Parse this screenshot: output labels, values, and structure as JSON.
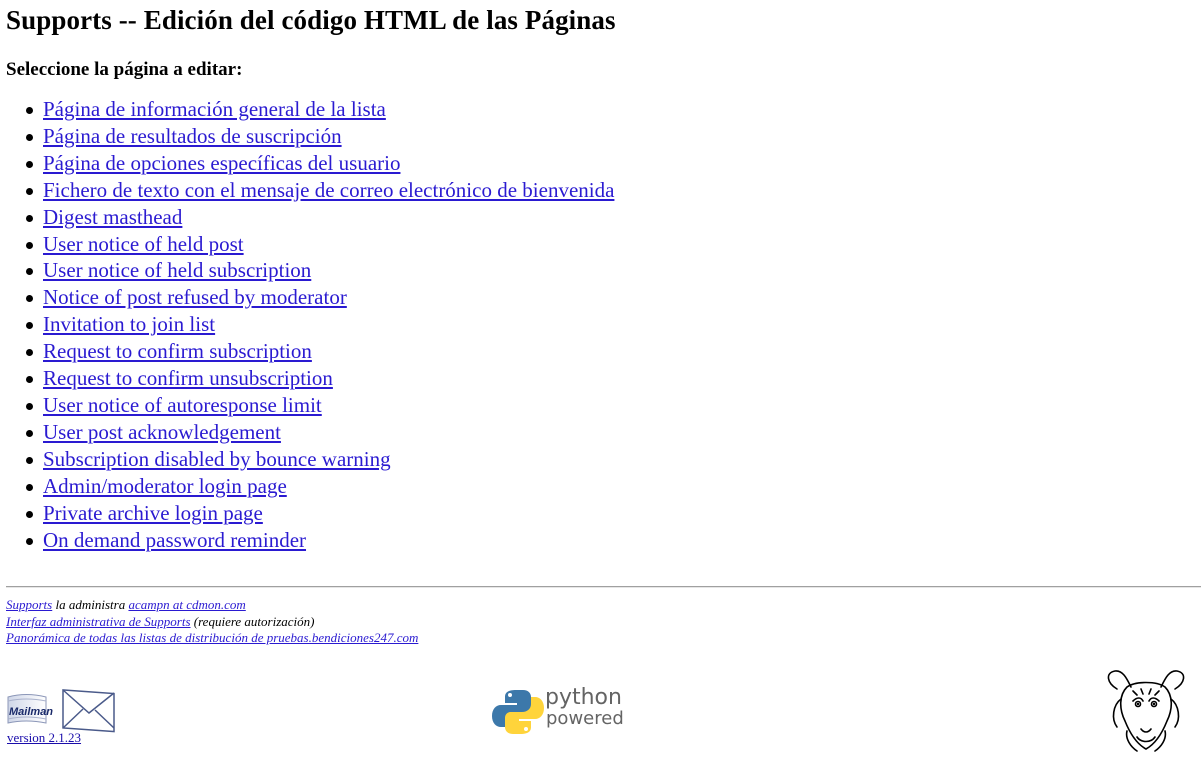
{
  "page": {
    "title": "Supports -- Edición del código HTML de las Páginas",
    "subtitle": "Seleccione la página a editar:"
  },
  "items": [
    "Página de información general de la lista",
    "Página de resultados de suscripción",
    "Página de opciones específicas del usuario",
    "Fichero de texto con el mensaje de correo electrónico de bienvenida",
    "Digest masthead",
    "User notice of held post",
    "User notice of held subscription",
    "Notice of post refused by moderator",
    "Invitation to join list",
    "Request to confirm subscription",
    "Request to confirm unsubscription",
    "User notice of autoresponse limit",
    "User post acknowledgement",
    "Subscription disabled by bounce warning",
    "Admin/moderator login page",
    "Private archive login page",
    "On demand password reminder"
  ],
  "footer": {
    "list_name": "Supports",
    "admin_text": " la administra ",
    "admin_email": "acampn at cdmon.com",
    "admin_interface_link": "Interfaz administrativa de Supports",
    "admin_interface_note": " (requiere autorización)",
    "overview_link": "Panorámica de todas las listas de distribución de pruebas.bendiciones247.com"
  },
  "logos": {
    "mailman_label": "Mailman",
    "mailman_version": "version 2.1.23",
    "python_top": "python",
    "python_bottom": "powered",
    "icons": [
      "mailman-logo-icon",
      "python-logo-icon",
      "gnu-head-icon"
    ]
  },
  "colors": {
    "link": "#2a1ad1",
    "python_blue": "#3c78aa",
    "python_yellow": "#ffd43b"
  }
}
